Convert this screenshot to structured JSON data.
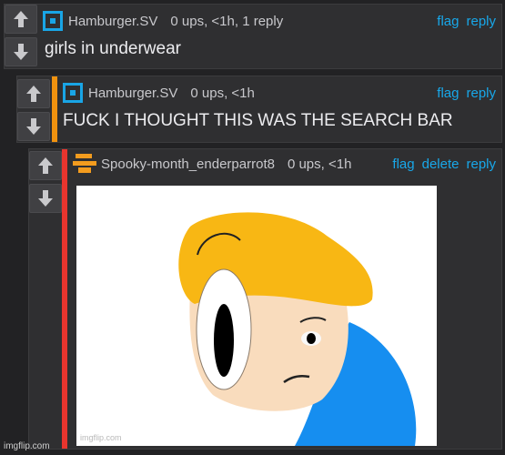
{
  "comments": [
    {
      "author": "Hamburger.SV",
      "meta": "0 ups, <1h, 1 reply",
      "text": "girls in underwear",
      "actions": [
        "flag",
        "reply"
      ],
      "avatar_icon": "square-avatar-icon",
      "accent_color": ""
    },
    {
      "author": "Hamburger.SV",
      "meta": "0 ups, <1h",
      "text": "FUCK I THOUGHT THIS WAS THE SEARCH BAR",
      "actions": [
        "flag",
        "reply"
      ],
      "avatar_icon": "square-avatar-icon",
      "accent_color": "#f0920f"
    },
    {
      "author": "Spooky-month_enderparrot8",
      "meta": "0 ups, <1h",
      "text": "",
      "actions": [
        "flag",
        "delete",
        "reply"
      ],
      "avatar_icon": "orange-avatar-icon",
      "accent_color": "#e8352e",
      "image_watermark": "imgflip.com"
    }
  ],
  "vote_icons": [
    "upvote-arrow-icon",
    "downvote-arrow-icon"
  ],
  "site_watermark": "imgflip.com",
  "colors": {
    "background": "#222224",
    "comment_bg": "#2f2f31",
    "link": "#18a8ea",
    "avatar_blue": "#19a5e6"
  }
}
